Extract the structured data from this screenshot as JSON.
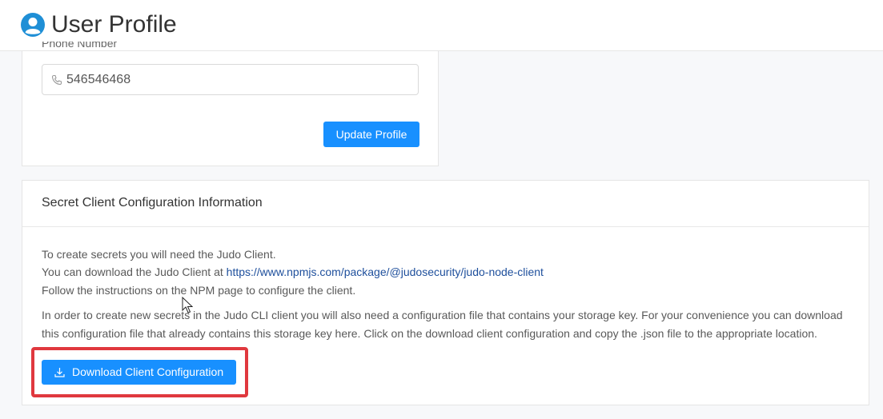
{
  "header": {
    "title": "User Profile"
  },
  "profile_form": {
    "phone_label": "Phone Number",
    "phone_value": "546546468",
    "update_button": "Update Profile"
  },
  "secret_config": {
    "title": "Secret Client Configuration Information",
    "line1": "To create secrets you will need the Judo Client.",
    "line2_prefix": "You can download the Judo Client at ",
    "line2_link": "https://www.npmjs.com/package/@judosecurity/judo-node-client",
    "line3": "Follow the instructions on the NPM page to configure the client.",
    "para2_line1": "In order to create new secrets in the Judo CLI client you will also need a configuration file that contains your storage key. For your convenience you can download",
    "para2_line2": "this configuration file that already contains this storage key here. Click on the download client configuration and copy the .json file to the appropriate location.",
    "download_button": "Download Client Configuration"
  },
  "colors": {
    "primary": "#1890ff",
    "link": "#1e4f9c",
    "highlight": "#e0383e",
    "header_icon": "#1f8fd6"
  },
  "icons": [
    "user-circle-icon",
    "phone-icon",
    "download-icon",
    "mouse-cursor-icon"
  ]
}
